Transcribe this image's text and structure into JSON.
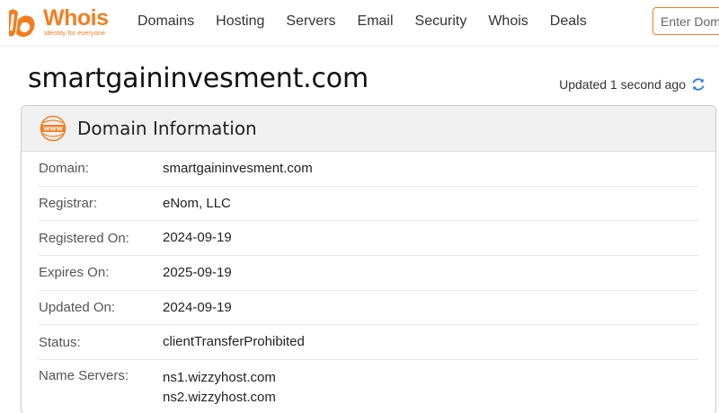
{
  "header": {
    "logo_text": "Whois",
    "logo_tagline": "Identity for everyone",
    "nav": [
      "Domains",
      "Hosting",
      "Servers",
      "Email",
      "Security",
      "Whois",
      "Deals"
    ],
    "search_placeholder": "Enter Domain or IP"
  },
  "page": {
    "title": "smartgaininvesment.com",
    "updated": "Updated 1 second ago"
  },
  "card": {
    "title": "Domain Information",
    "rows": [
      {
        "label": "Domain:",
        "value": "smartgaininvesment.com"
      },
      {
        "label": "Registrar:",
        "value": "eNom, LLC"
      },
      {
        "label": "Registered On:",
        "value": "2024-09-19"
      },
      {
        "label": "Expires On:",
        "value": "2025-09-19"
      },
      {
        "label": "Updated On:",
        "value": "2024-09-19"
      },
      {
        "label": "Status:",
        "value": "clientTransferProhibited"
      },
      {
        "label": "Name Servers:",
        "values": [
          "ns1.wizzyhost.com",
          "ns2.wizzyhost.com"
        ]
      }
    ]
  },
  "colors": {
    "brand": "#f47d20",
    "refresh": "#2a7de1"
  }
}
